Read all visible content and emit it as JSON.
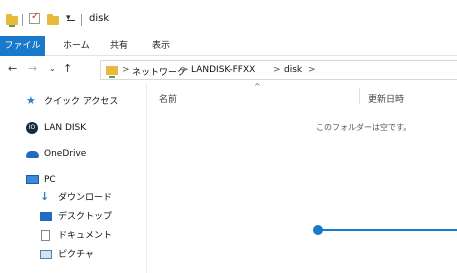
{
  "window": {
    "title": "disk"
  },
  "quick_access_toolbar": {
    "icons": [
      "folder-icon",
      "properties-check-icon",
      "new-folder-icon",
      "customize-dropdown-icon"
    ],
    "dropdown_glyph": "▾"
  },
  "ribbon": {
    "tabs": [
      {
        "label": "ファイル"
      },
      {
        "label": "ホーム"
      },
      {
        "label": "共有"
      },
      {
        "label": "表示"
      }
    ]
  },
  "address_bar": {
    "breadcrumbs": [
      "ネットワーク",
      "LANDISK-FFXX",
      "disk"
    ],
    "separator": ">"
  },
  "navigation_pane": {
    "items": [
      {
        "label": "クイック アクセス",
        "icon": "star-icon"
      },
      {
        "label": "LAN DISK",
        "icon": "landisk-icon"
      },
      {
        "label": "OneDrive",
        "icon": "cloud-icon"
      },
      {
        "label": "PC",
        "icon": "pc-icon"
      },
      {
        "label": "ダウンロード",
        "icon": "download-icon"
      },
      {
        "label": "デスクトップ",
        "icon": "desktop-icon"
      },
      {
        "label": "ドキュメント",
        "icon": "document-icon"
      },
      {
        "label": "ピクチャ",
        "icon": "pictures-icon"
      }
    ]
  },
  "content": {
    "columns": [
      "名前",
      "更新日時"
    ],
    "empty_message": "このフォルダーは空です。"
  },
  "colors": {
    "accent": "#1979ca",
    "folder": "#e8b93a",
    "star": "#2f7fd0"
  }
}
